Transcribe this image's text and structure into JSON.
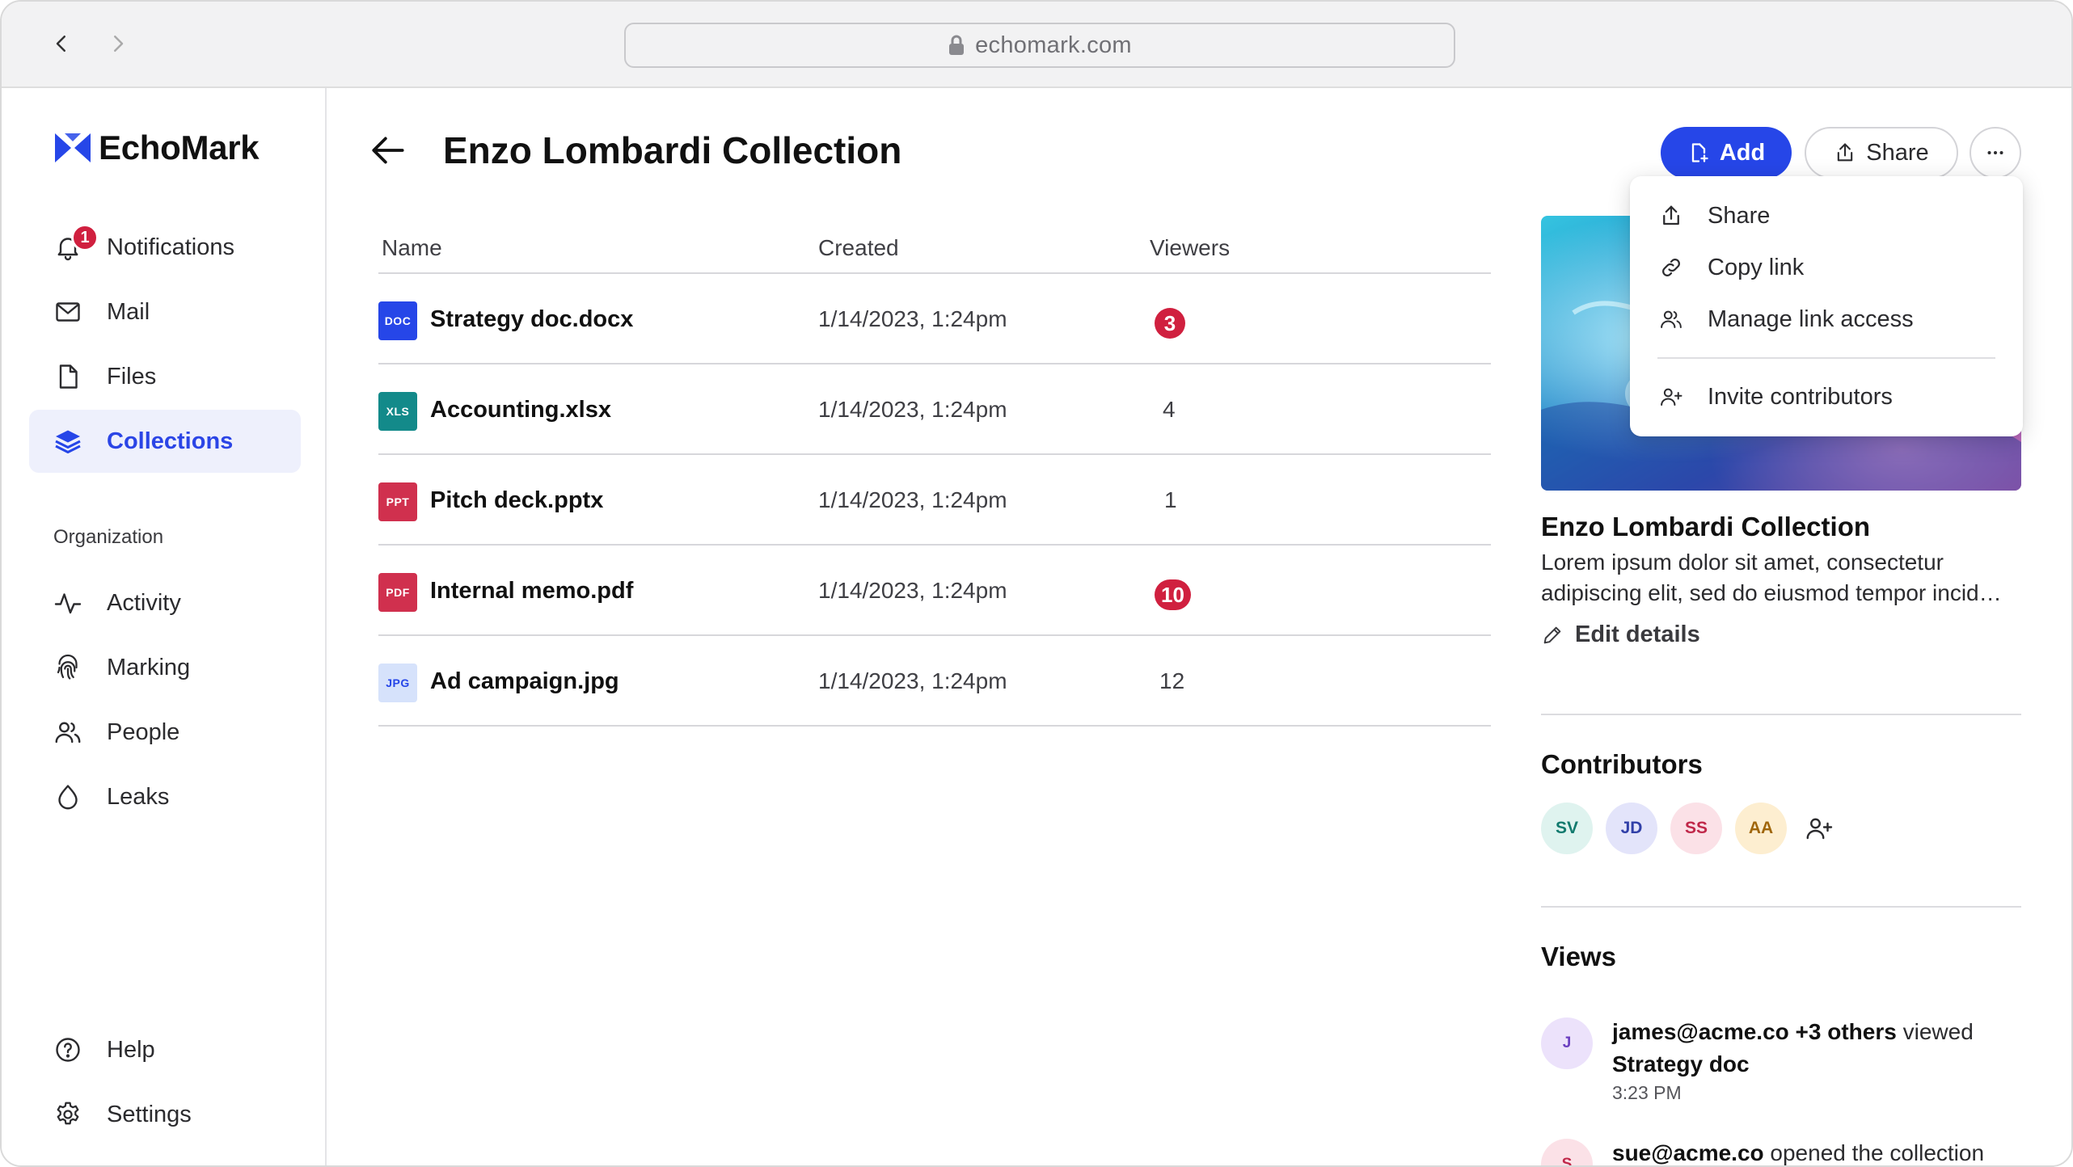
{
  "browser": {
    "url": "echomark.com"
  },
  "sidebar": {
    "brand": "EchoMark",
    "notifications_count": "1",
    "items": [
      {
        "label": "Notifications",
        "icon": "bell-icon"
      },
      {
        "label": "Mail",
        "icon": "mail-icon"
      },
      {
        "label": "Files",
        "icon": "file-icon"
      },
      {
        "label": "Collections",
        "icon": "layers-icon",
        "active": true
      }
    ],
    "org_section_label": "Organization",
    "org_items": [
      {
        "label": "Activity",
        "icon": "activity-icon"
      },
      {
        "label": "Marking",
        "icon": "fingerprint-icon"
      },
      {
        "label": "People",
        "icon": "people-icon"
      },
      {
        "label": "Leaks",
        "icon": "droplet-icon"
      }
    ],
    "footer_items": [
      {
        "label": "Help",
        "icon": "help-icon"
      },
      {
        "label": "Settings",
        "icon": "gear-icon"
      }
    ]
  },
  "header": {
    "title": "Enzo Lombardi Collection",
    "add_label": "Add",
    "share_label": "Share"
  },
  "table": {
    "columns": [
      "Name",
      "Created",
      "Viewers"
    ],
    "rows": [
      {
        "type": "DOC",
        "name": "Strategy doc.docx",
        "created": "1/14/2023, 1:24pm",
        "viewers": "3",
        "highlight": true
      },
      {
        "type": "XLS",
        "name": "Accounting.xlsx",
        "created": "1/14/2023, 1:24pm",
        "viewers": "4",
        "highlight": false
      },
      {
        "type": "PPT",
        "name": "Pitch deck.pptx",
        "created": "1/14/2023, 1:24pm",
        "viewers": "1",
        "highlight": false
      },
      {
        "type": "PDF",
        "name": "Internal memo.pdf",
        "created": "1/14/2023, 1:24pm",
        "viewers": "10",
        "highlight": true
      },
      {
        "type": "JPG",
        "name": "Ad campaign.jpg",
        "created": "1/14/2023, 1:24pm",
        "viewers": "12",
        "highlight": false
      }
    ]
  },
  "panel": {
    "title": "Enzo Lombardi Collection",
    "description": "Lorem ipsum dolor sit amet, consectetur adipiscing elit, sed do eiusmod tempor incid…",
    "edit_label": "Edit details",
    "contributors_title": "Contributors",
    "contributors": [
      "SV",
      "JD",
      "SS",
      "AA"
    ],
    "views_title": "Views",
    "views": [
      {
        "avatar": "J",
        "actor": "james@acme.co +3 others",
        "action": " viewed",
        "target": "Strategy doc",
        "time": "3:23 PM"
      },
      {
        "avatar": "S",
        "actor": "sue@acme.co",
        "action": " opened the collection",
        "target": "",
        "time": ""
      }
    ]
  },
  "menu": {
    "items": [
      "Share",
      "Copy link",
      "Manage link access",
      "Invite contributors"
    ]
  },
  "colors": {
    "accent": "#2646e8",
    "badge": "#d0203f",
    "doc": "#2646e8",
    "xls": "#138a8a",
    "ppt": "#d0304e",
    "pdf": "#d0304e",
    "jpg": "#d6e2fb"
  }
}
